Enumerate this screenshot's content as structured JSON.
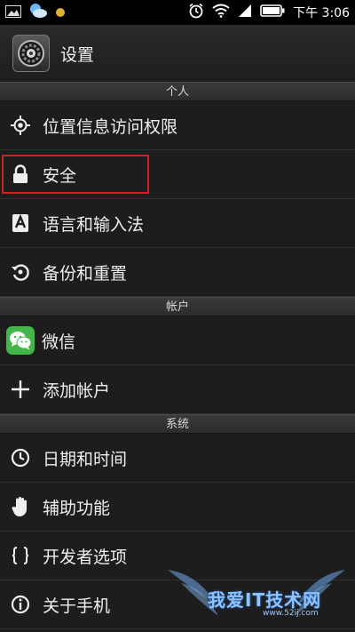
{
  "status_bar": {
    "time": "下午 3:06",
    "icons": [
      "picture-icon",
      "weather-icon",
      "dot-icon",
      "alarm-icon",
      "wifi-icon",
      "signal-icon",
      "battery-icon"
    ]
  },
  "action_bar": {
    "title": "设置",
    "icon": "settings-gear-icon"
  },
  "sections": [
    {
      "header": "个人",
      "items": [
        {
          "label": "位置信息访问权限",
          "icon": "location-icon"
        },
        {
          "label": "安全",
          "icon": "lock-icon",
          "highlighted": true
        },
        {
          "label": "语言和输入法",
          "icon": "keyboard-a-icon"
        },
        {
          "label": "备份和重置",
          "icon": "backup-icon"
        }
      ]
    },
    {
      "header": "帐户",
      "items": [
        {
          "label": "微信",
          "icon": "wechat-icon"
        },
        {
          "label": "添加帐户",
          "icon": "plus-icon"
        }
      ]
    },
    {
      "header": "系统",
      "items": [
        {
          "label": "日期和时间",
          "icon": "clock-icon"
        },
        {
          "label": "辅助功能",
          "icon": "hand-icon"
        },
        {
          "label": "开发者选项",
          "icon": "braces-icon"
        },
        {
          "label": "关于手机",
          "icon": "info-icon"
        }
      ]
    }
  ],
  "watermark": {
    "text": "我爱IT技术网",
    "url": "www.52ij.com"
  },
  "colors": {
    "highlight_border": "#d11f23",
    "wechat_green": "#44b549",
    "background": "#1c1c1c"
  }
}
